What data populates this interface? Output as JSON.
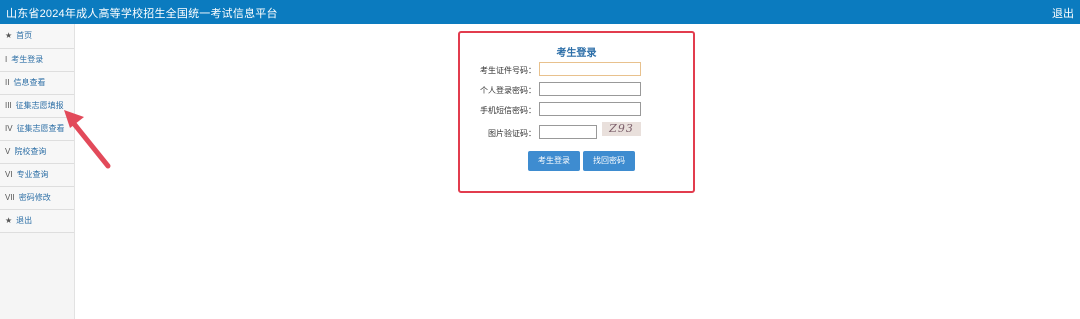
{
  "header": {
    "title": "山东省2024年成人高等学校招生全国统一考试信息平台",
    "logout_label": "退出"
  },
  "sidebar": {
    "items": [
      {
        "num": "★",
        "label": "首页"
      },
      {
        "num": "I",
        "label": "考生登录"
      },
      {
        "num": "II",
        "label": "信息查看"
      },
      {
        "num": "III",
        "label": "征集志愿填报"
      },
      {
        "num": "IV",
        "label": "征集志愿查看"
      },
      {
        "num": "V",
        "label": "院校查询"
      },
      {
        "num": "VI",
        "label": "专业查询"
      },
      {
        "num": "VII",
        "label": "密码修改"
      },
      {
        "num": "★",
        "label": "退出"
      }
    ]
  },
  "login": {
    "title": "考生登录",
    "id_label": "考生证件号码：",
    "password_label": "个人登录密码：",
    "sms_label": "手机短信密码：",
    "captcha_label": "图片验证码：",
    "captcha_text": "Z93",
    "submit_label": "考生登录",
    "reset_label": "找回密码"
  },
  "colors": {
    "header_bg": "#0b7bbf",
    "highlight_border": "#e23c4e",
    "button_bg": "#3e8cd0",
    "arrow": "#e24a5a"
  }
}
